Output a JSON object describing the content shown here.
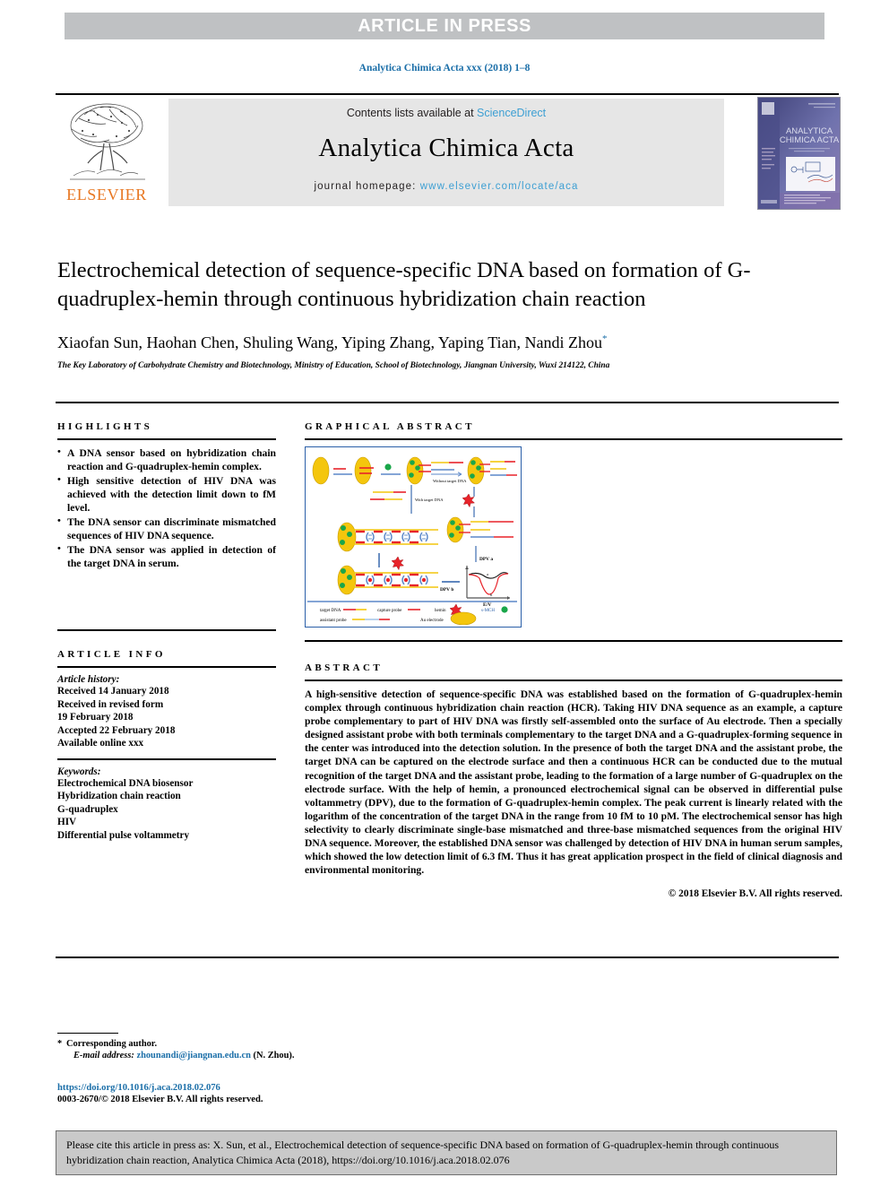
{
  "banner": {
    "text": "ARTICLE IN PRESS"
  },
  "running_head": "Analytica Chimica Acta xxx (2018) 1–8",
  "masthead": {
    "publisher": "ELSEVIER",
    "contents_prefix": "Contents lists available at ",
    "contents_link": "ScienceDirect",
    "journal_title": "Analytica Chimica Acta",
    "homepage_prefix": "journal homepage: ",
    "homepage_link": "www.elsevier.com/locate/aca",
    "cover_title_line1": "ANALYTICA",
    "cover_title_line2": "CHIMICA ACTA"
  },
  "article": {
    "title": "Electrochemical detection of sequence-specific DNA based on formation of G-quadruplex-hemin through continuous hybridization chain reaction",
    "authors": "Xiaofan Sun, Haohan Chen, Shuling Wang, Yiping Zhang, Yaping Tian, Nandi Zhou",
    "corresponding_marker": "*",
    "affiliation": "The Key Laboratory of Carbohydrate Chemistry and Biotechnology, Ministry of Education, School of Biotechnology, Jiangnan University, Wuxi 214122, China"
  },
  "highlights": {
    "heading": "HIGHLIGHTS",
    "items": [
      "A DNA sensor based on hybridization chain reaction and G-quadruplex-hemin complex.",
      "High sensitive detection of HIV DNA was achieved with the detection limit down to fM level.",
      "The DNA sensor can discriminate mismatched sequences of HIV DNA sequence.",
      "The DNA sensor was applied in detection of the target DNA in serum."
    ]
  },
  "article_info": {
    "heading": "ARTICLE INFO",
    "history_label": "Article history:",
    "history": [
      "Received 14 January 2018",
      "Received in revised form",
      "19 February 2018",
      "Accepted 22 February 2018",
      "Available online xxx"
    ],
    "keywords_label": "Keywords:",
    "keywords": [
      "Electrochemical DNA biosensor",
      "Hybridization chain reaction",
      "G-quadruplex",
      "HIV",
      "Differential pulse voltammetry"
    ]
  },
  "graphical_abstract": {
    "heading": "GRAPHICAL ABSTRACT",
    "figure_labels": {
      "without_target": "Without target DNA",
      "with_target": "With target DNA",
      "dpv_a": "DPV a",
      "dpv_b": "DPV b",
      "axis_x": "E/V",
      "curve_a": "a",
      "curve_b": "b"
    },
    "legend": [
      {
        "label": "target DNA",
        "symbol": "line-red-yellow"
      },
      {
        "label": "capture probe",
        "symbol": "line-red"
      },
      {
        "label": "hemin",
        "symbol": "red-star"
      },
      {
        "label": "s-MCH",
        "symbol": "green-dot"
      },
      {
        "label": "assistant probe",
        "symbol": "line-yellow-blue-red"
      },
      {
        "label": "Au electrode",
        "symbol": "yellow-ellipse"
      }
    ],
    "colors": {
      "border": "#2a5fa8",
      "target_dna": "#e8232a",
      "capture_probe": "#e8232a",
      "assistant_yellow": "#f2c200",
      "assistant_blue": "#6fa8dc",
      "hemin": "#e8232a",
      "smch": "#1aa64a",
      "electrode": "#f2c200"
    }
  },
  "abstract": {
    "heading": "ABSTRACT",
    "body": "A high-sensitive detection of sequence-specific DNA was established based on the formation of G-quadruplex-hemin complex through continuous hybridization chain reaction (HCR). Taking HIV DNA sequence as an example, a capture probe complementary to part of HIV DNA was firstly self-assembled onto the surface of Au electrode. Then a specially designed assistant probe with both terminals complementary to the target DNA and a G-quadruplex-forming sequence in the center was introduced into the detection solution. In the presence of both the target DNA and the assistant probe, the target DNA can be captured on the electrode surface and then a continuous HCR can be conducted due to the mutual recognition of the target DNA and the assistant probe, leading to the formation of a large number of G-quadruplex on the electrode surface. With the help of hemin, a pronounced electrochemical signal can be observed in differential pulse voltammetry (DPV), due to the formation of G-quadruplex-hemin complex. The peak current is linearly related with the logarithm of the concentration of the target DNA in the range from 10 fM to 10 pM. The electrochemical sensor has high selectivity to clearly discriminate single-base mismatched and three-base mismatched sequences from the original HIV DNA sequence. Moreover, the established DNA sensor was challenged by detection of HIV DNA in human serum samples, which showed the low detection limit of 6.3 fM. Thus it has great application prospect in the field of clinical diagnosis and environmental monitoring.",
    "copyright": "© 2018 Elsevier B.V. All rights reserved."
  },
  "footnotes": {
    "corresponding": "Corresponding author.",
    "email_label": "E-mail address:",
    "email": "zhounandi@jiangnan.edu.cn",
    "email_suffix": "(N. Zhou).",
    "doi": "https://doi.org/10.1016/j.aca.2018.02.076",
    "issn": "0003-2670/© 2018 Elsevier B.V. All rights reserved."
  },
  "cite_box": {
    "text": "Please cite this article in press as: X. Sun, et al., Electrochemical detection of sequence-specific DNA based on formation of G-quadruplex-hemin through continuous hybridization chain reaction, Analytica Chimica Acta (2018), https://doi.org/10.1016/j.aca.2018.02.076"
  }
}
